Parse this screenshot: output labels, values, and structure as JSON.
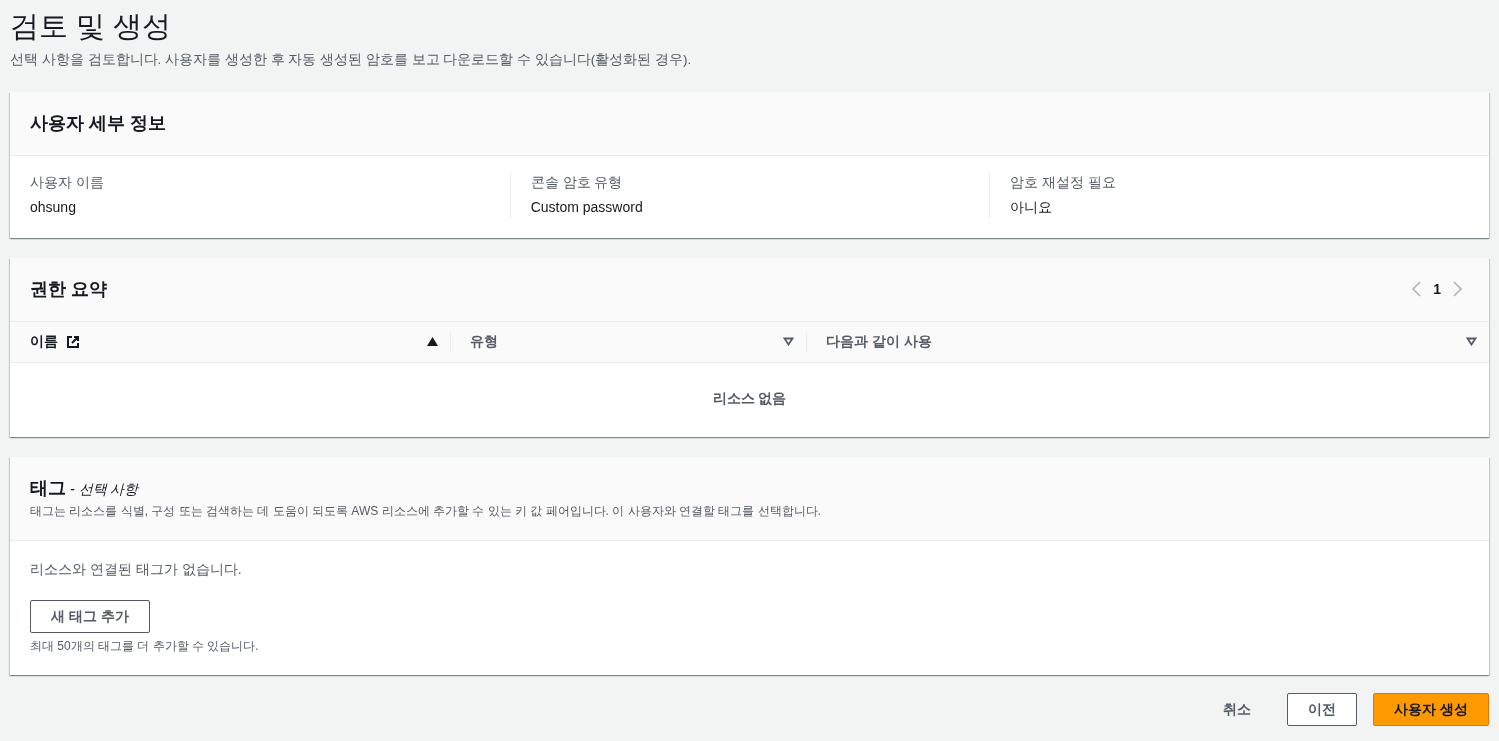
{
  "page": {
    "title": "검토 및 생성",
    "description": "선택 사항을 검토합니다. 사용자를 생성한 후 자동 생성된 암호를 보고 다운로드할 수 있습니다(활성화된 경우)."
  },
  "user_details": {
    "title": "사용자 세부 정보",
    "fields": [
      {
        "label": "사용자 이름",
        "value": "ohsung"
      },
      {
        "label": "콘솔 암호 유형",
        "value": "Custom password"
      },
      {
        "label": "암호 재설정 필요",
        "value": "아니요"
      }
    ]
  },
  "permissions_summary": {
    "title": "권한 요약",
    "pagination": {
      "prev_disabled": true,
      "next_disabled": true,
      "pages": [
        {
          "label": "1",
          "selected": true
        }
      ]
    },
    "columns": [
      {
        "label": "이름",
        "kind": "link",
        "sorted": true
      },
      {
        "label": "유형",
        "kind": "text",
        "sorted": false
      },
      {
        "label": "다음과 같이 사용",
        "kind": "text",
        "sorted": false
      }
    ],
    "empty_message": "리소스 없음"
  },
  "tags": {
    "title": "태그",
    "optional_label": "- 선택 사항",
    "description": "태그는 리소스를 식별, 구성 또는 검색하는 데 도움이 되도록 AWS 리소스에 추가할 수 있는 키 값 페어입니다. 이 사용자와 연결할 태그를 선택합니다.",
    "empty_message": "리소스와 연결된 태그가 없습니다.",
    "add_button": "새 태그 추가",
    "hint": "최대 50개의 태그를 더 추가할 수 있습니다."
  },
  "actions": [
    {
      "label": "취소",
      "kind": "link"
    },
    {
      "label": "이전",
      "kind": "secondary"
    },
    {
      "label": "사용자 생성",
      "kind": "primary"
    }
  ]
}
